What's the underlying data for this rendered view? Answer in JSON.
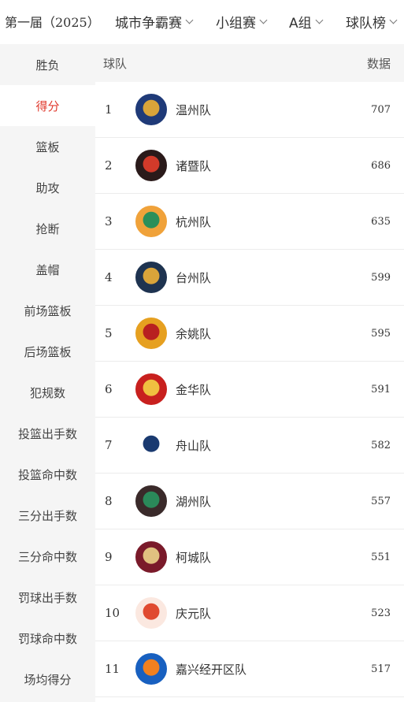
{
  "topbar": {
    "season": "第一届（2025）",
    "filters": [
      "城市争霸赛",
      "小组赛",
      "A组",
      "球队榜"
    ]
  },
  "sidebar": {
    "active_index": 1,
    "items": [
      "胜负",
      "得分",
      "篮板",
      "助攻",
      "抢断",
      "盖帽",
      "前场篮板",
      "后场篮板",
      "犯规数",
      "投篮出手数",
      "投篮命中数",
      "三分出手数",
      "三分命中数",
      "罚球出手数",
      "罚球命中数",
      "场均得分"
    ]
  },
  "table": {
    "headers": {
      "team": "球队",
      "value": "数据"
    },
    "rows": [
      {
        "rank": "1",
        "team": "温州队",
        "value": "707",
        "logo_color": "#1f3a78",
        "accent": "#d9a43a"
      },
      {
        "rank": "2",
        "team": "诸暨队",
        "value": "686",
        "logo_color": "#2a1a1a",
        "accent": "#d23a2a"
      },
      {
        "rank": "3",
        "team": "杭州队",
        "value": "635",
        "logo_color": "#f0a23a",
        "accent": "#2b8f5a"
      },
      {
        "rank": "4",
        "team": "台州队",
        "value": "599",
        "logo_color": "#1e3350",
        "accent": "#d9a43a"
      },
      {
        "rank": "5",
        "team": "余姚队",
        "value": "595",
        "logo_color": "#e6a020",
        "accent": "#b82020"
      },
      {
        "rank": "6",
        "team": "金华队",
        "value": "591",
        "logo_color": "#c8201e",
        "accent": "#f0c040"
      },
      {
        "rank": "7",
        "team": "舟山队",
        "value": "582",
        "logo_color": "#ffffff",
        "accent": "#1a3a70"
      },
      {
        "rank": "8",
        "team": "湖州队",
        "value": "557",
        "logo_color": "#3a2a2a",
        "accent": "#2a8a5a"
      },
      {
        "rank": "9",
        "team": "柯城队",
        "value": "551",
        "logo_color": "#7a1a2a",
        "accent": "#e0c080"
      },
      {
        "rank": "10",
        "team": "庆元队",
        "value": "523",
        "logo_color": "#fbe8e0",
        "accent": "#e04a30"
      },
      {
        "rank": "11",
        "team": "嘉兴经开区队",
        "value": "517",
        "logo_color": "#1860c0",
        "accent": "#f08020"
      }
    ]
  }
}
